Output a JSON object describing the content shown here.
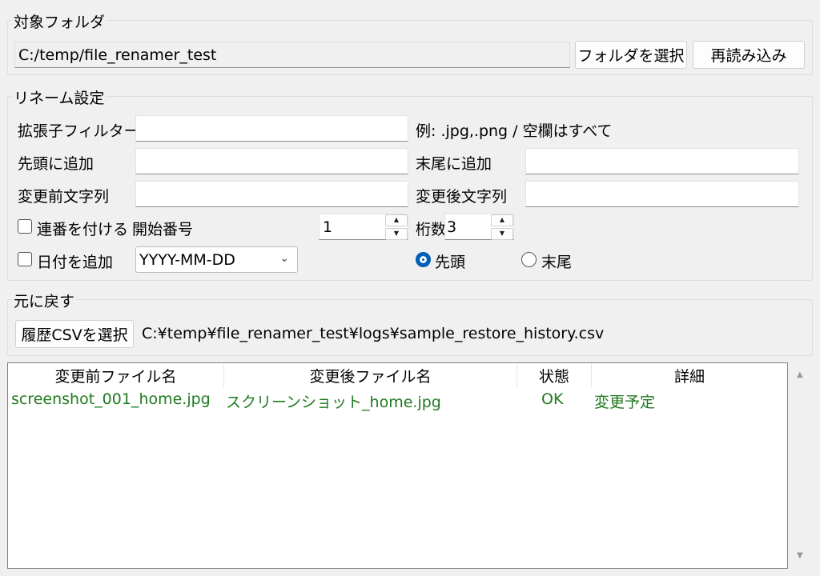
{
  "target_folder": {
    "group_label": "対象フォルダ",
    "path_value": "C:/temp/file_renamer_test",
    "select_button": "フォルダを選択",
    "reload_button": "再読み込み"
  },
  "rename_settings": {
    "group_label": "リネーム設定",
    "ext_filter_label": "拡張子フィルター",
    "ext_filter_value": "",
    "ext_hint": "例: .jpg,.png / 空欄はすべて",
    "prefix_label": "先頭に追加",
    "prefix_value": "",
    "suffix_label": "末尾に追加",
    "suffix_value": "",
    "before_label": "変更前文字列",
    "before_value": "",
    "after_label": "変更後文字列",
    "after_value": "",
    "serial_checkbox_label": "連番を付ける",
    "serial_checked": false,
    "start_number_label": "開始番号",
    "start_number_value": "1",
    "digits_label": "桁数",
    "digits_value": "3",
    "date_checkbox_label": "日付を追加",
    "date_checked": false,
    "date_format_value": "YYYY-MM-DD",
    "position_head_label": "先頭",
    "position_tail_label": "末尾",
    "position_selected": "先頭"
  },
  "restore": {
    "group_label": "元に戻す",
    "select_csv_button": "履歴CSVを選択",
    "csv_path": "C:¥temp¥file_renamer_test¥logs¥sample_restore_history.csv"
  },
  "table": {
    "headers": [
      "変更前ファイル名",
      "変更後ファイル名",
      "状態",
      "詳細"
    ],
    "rows": [
      [
        "screenshot_001_home.jpg",
        "スクリーンショット_home.jpg",
        "OK",
        "変更予定"
      ]
    ]
  },
  "colors": {
    "row_text": "#1f7a1f",
    "accent": "#005fb8"
  },
  "icons": {
    "dropdown": "chevron-down-icon",
    "spin_up": "caret-up-icon",
    "spin_down": "caret-down-icon",
    "scroll_up": "scroll-up-arrow-icon",
    "scroll_down": "scroll-down-arrow-icon"
  }
}
